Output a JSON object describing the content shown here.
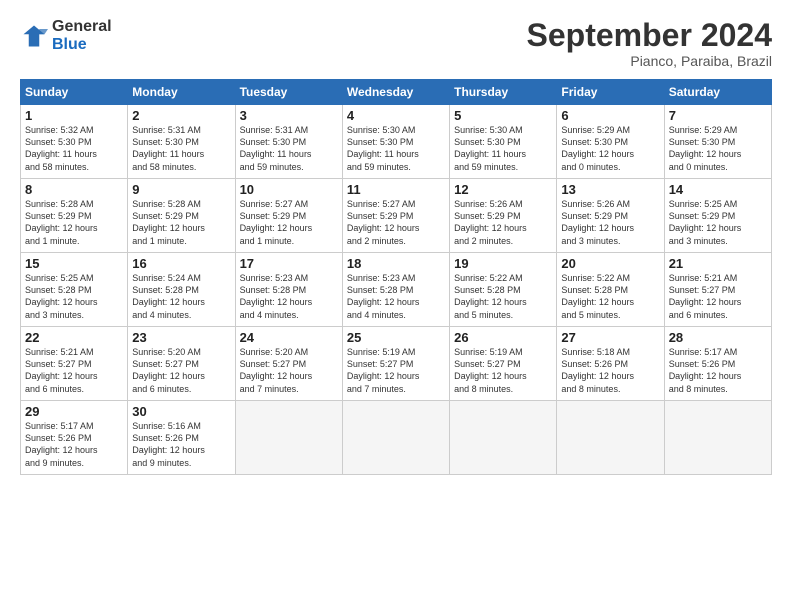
{
  "header": {
    "logo_line1": "General",
    "logo_line2": "Blue",
    "month": "September 2024",
    "location": "Pianco, Paraiba, Brazil"
  },
  "days_of_week": [
    "Sunday",
    "Monday",
    "Tuesday",
    "Wednesday",
    "Thursday",
    "Friday",
    "Saturday"
  ],
  "weeks": [
    [
      {
        "num": "1",
        "info": "Sunrise: 5:32 AM\nSunset: 5:30 PM\nDaylight: 11 hours\nand 58 minutes."
      },
      {
        "num": "2",
        "info": "Sunrise: 5:31 AM\nSunset: 5:30 PM\nDaylight: 11 hours\nand 58 minutes."
      },
      {
        "num": "3",
        "info": "Sunrise: 5:31 AM\nSunset: 5:30 PM\nDaylight: 11 hours\nand 59 minutes."
      },
      {
        "num": "4",
        "info": "Sunrise: 5:30 AM\nSunset: 5:30 PM\nDaylight: 11 hours\nand 59 minutes."
      },
      {
        "num": "5",
        "info": "Sunrise: 5:30 AM\nSunset: 5:30 PM\nDaylight: 11 hours\nand 59 minutes."
      },
      {
        "num": "6",
        "info": "Sunrise: 5:29 AM\nSunset: 5:30 PM\nDaylight: 12 hours\nand 0 minutes."
      },
      {
        "num": "7",
        "info": "Sunrise: 5:29 AM\nSunset: 5:30 PM\nDaylight: 12 hours\nand 0 minutes."
      }
    ],
    [
      {
        "num": "8",
        "info": "Sunrise: 5:28 AM\nSunset: 5:29 PM\nDaylight: 12 hours\nand 1 minute."
      },
      {
        "num": "9",
        "info": "Sunrise: 5:28 AM\nSunset: 5:29 PM\nDaylight: 12 hours\nand 1 minute."
      },
      {
        "num": "10",
        "info": "Sunrise: 5:27 AM\nSunset: 5:29 PM\nDaylight: 12 hours\nand 1 minute."
      },
      {
        "num": "11",
        "info": "Sunrise: 5:27 AM\nSunset: 5:29 PM\nDaylight: 12 hours\nand 2 minutes."
      },
      {
        "num": "12",
        "info": "Sunrise: 5:26 AM\nSunset: 5:29 PM\nDaylight: 12 hours\nand 2 minutes."
      },
      {
        "num": "13",
        "info": "Sunrise: 5:26 AM\nSunset: 5:29 PM\nDaylight: 12 hours\nand 3 minutes."
      },
      {
        "num": "14",
        "info": "Sunrise: 5:25 AM\nSunset: 5:29 PM\nDaylight: 12 hours\nand 3 minutes."
      }
    ],
    [
      {
        "num": "15",
        "info": "Sunrise: 5:25 AM\nSunset: 5:28 PM\nDaylight: 12 hours\nand 3 minutes."
      },
      {
        "num": "16",
        "info": "Sunrise: 5:24 AM\nSunset: 5:28 PM\nDaylight: 12 hours\nand 4 minutes."
      },
      {
        "num": "17",
        "info": "Sunrise: 5:23 AM\nSunset: 5:28 PM\nDaylight: 12 hours\nand 4 minutes."
      },
      {
        "num": "18",
        "info": "Sunrise: 5:23 AM\nSunset: 5:28 PM\nDaylight: 12 hours\nand 4 minutes."
      },
      {
        "num": "19",
        "info": "Sunrise: 5:22 AM\nSunset: 5:28 PM\nDaylight: 12 hours\nand 5 minutes."
      },
      {
        "num": "20",
        "info": "Sunrise: 5:22 AM\nSunset: 5:28 PM\nDaylight: 12 hours\nand 5 minutes."
      },
      {
        "num": "21",
        "info": "Sunrise: 5:21 AM\nSunset: 5:27 PM\nDaylight: 12 hours\nand 6 minutes."
      }
    ],
    [
      {
        "num": "22",
        "info": "Sunrise: 5:21 AM\nSunset: 5:27 PM\nDaylight: 12 hours\nand 6 minutes."
      },
      {
        "num": "23",
        "info": "Sunrise: 5:20 AM\nSunset: 5:27 PM\nDaylight: 12 hours\nand 6 minutes."
      },
      {
        "num": "24",
        "info": "Sunrise: 5:20 AM\nSunset: 5:27 PM\nDaylight: 12 hours\nand 7 minutes."
      },
      {
        "num": "25",
        "info": "Sunrise: 5:19 AM\nSunset: 5:27 PM\nDaylight: 12 hours\nand 7 minutes."
      },
      {
        "num": "26",
        "info": "Sunrise: 5:19 AM\nSunset: 5:27 PM\nDaylight: 12 hours\nand 8 minutes."
      },
      {
        "num": "27",
        "info": "Sunrise: 5:18 AM\nSunset: 5:26 PM\nDaylight: 12 hours\nand 8 minutes."
      },
      {
        "num": "28",
        "info": "Sunrise: 5:17 AM\nSunset: 5:26 PM\nDaylight: 12 hours\nand 8 minutes."
      }
    ],
    [
      {
        "num": "29",
        "info": "Sunrise: 5:17 AM\nSunset: 5:26 PM\nDaylight: 12 hours\nand 9 minutes."
      },
      {
        "num": "30",
        "info": "Sunrise: 5:16 AM\nSunset: 5:26 PM\nDaylight: 12 hours\nand 9 minutes."
      },
      {
        "num": "",
        "info": ""
      },
      {
        "num": "",
        "info": ""
      },
      {
        "num": "",
        "info": ""
      },
      {
        "num": "",
        "info": ""
      },
      {
        "num": "",
        "info": ""
      }
    ]
  ]
}
